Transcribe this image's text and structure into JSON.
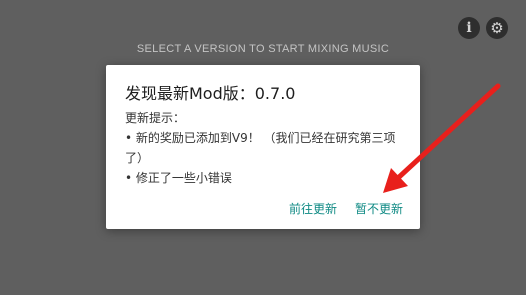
{
  "background": {
    "prompt": "SELECT A VERSION TO START MIXING MUSIC",
    "info_icon_glyph": "i",
    "settings_icon_glyph": "⚙"
  },
  "dialog": {
    "title": "发现最新Mod版：0.7.0",
    "intro": "更新提示：",
    "notes": [
      "• 新的奖励已添加到V9！ （我们已经在研究第三项了）",
      "• 修正了一些小错误"
    ],
    "buttons": {
      "update": "前往更新",
      "skip": "暂不更新"
    }
  },
  "colors": {
    "backdrop": "#5f5f5f",
    "accent": "#0f8a84",
    "annotation_arrow": "#e8201c"
  },
  "icons": {
    "info": "info-icon",
    "settings": "gear-icon",
    "annotation": "red-arrow-annotation"
  }
}
